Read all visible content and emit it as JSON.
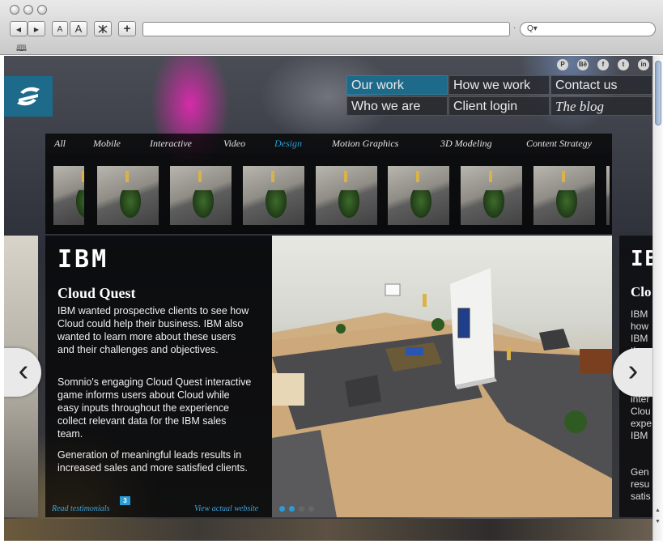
{
  "browser": {
    "back_label": "◀",
    "forward_label": "▶",
    "text_smaller_label": "A",
    "text_bigger_label": "A",
    "add_label": "+",
    "search_glyph": "Q▾",
    "bookmarks_glyph": "🕮"
  },
  "social": [
    "P",
    "Bē",
    "f",
    "t",
    "in"
  ],
  "nav": {
    "our_work": "Our work",
    "how_we_work": "How we work",
    "contact_us": "Contact us",
    "who_we_are": "Who we are",
    "client_login": "Client login",
    "the_blog": "The blog"
  },
  "filters": [
    "All",
    "Mobile",
    "Interactive",
    "Video",
    "Design",
    "Motion Graphics",
    "3D Modeling",
    "Content Strategy"
  ],
  "active_filter": "Design",
  "project": {
    "client_logo_text": "IBM",
    "title": "Cloud Quest",
    "paragraphs": [
      "IBM wanted prospective clients to see how Cloud could help their business. IBM also wanted to learn more about these users and their challenges and objectives.",
      "Somnio's engaging Cloud Quest interactive game informs users about Cloud while easy inputs throughout the experience collect relevant data for the IBM sales team.",
      "Generation of meaningful leads results in increased sales and more satisfied clients."
    ],
    "testimonials_label": "Read testimonials",
    "testimonials_count": "3",
    "website_label": "View actual website"
  },
  "next_peek": {
    "logo_text": "IBM",
    "title": "Clo",
    "lines": "IBM\nhow\nIBM\nthe\nobje\n\nSom\ninter\nClou\nexpe\nIBM\n\n\nGen\nresu\nsatis"
  },
  "slider": {
    "dot_count": 4,
    "active_dot": 1
  },
  "arrows": {
    "prev": "‹",
    "next": "›"
  },
  "colors": {
    "accent": "#1d6a8a",
    "link": "#2a9cd6"
  }
}
